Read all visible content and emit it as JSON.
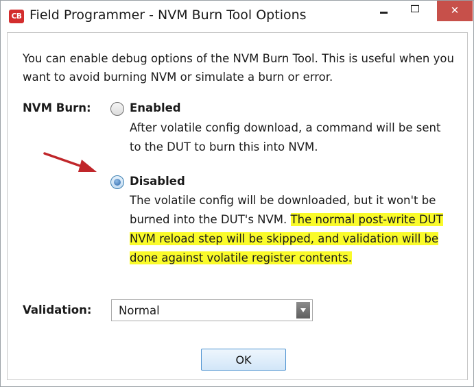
{
  "window": {
    "app_icon_text": "CB",
    "title": "Field Programmer - NVM Burn Tool Options",
    "close_glyph": "✕"
  },
  "intro": {
    "text": "You can enable debug options of the NVM Burn Tool. This is useful when you want to avoid burning NVM or simulate a burn or error."
  },
  "nvm_burn": {
    "label": "NVM Burn:",
    "options": [
      {
        "title": "Enabled",
        "checked": false,
        "description": "After volatile config download, a command will be sent to the DUT to burn this into NVM."
      },
      {
        "title": "Disabled",
        "checked": true,
        "description": "The volatile config will be downloaded, but it won't be burned into the DUT's NVM.",
        "highlighted_description": "The normal post-write DUT NVM reload step will be skipped, and validation will be done against volatile register contents."
      }
    ]
  },
  "validation": {
    "label": "Validation:",
    "selected": "Normal"
  },
  "ok_button": {
    "label": "OK"
  },
  "colors": {
    "highlight": "#fafb2a",
    "arrow": "#c0262a",
    "close_button": "#c7504a",
    "app_icon": "#d32d2d",
    "ok_border": "#4a90d0"
  },
  "icons": {
    "app": "cb-app-icon",
    "minimize": "minimize-icon",
    "maximize": "maximize-icon",
    "close": "close-icon",
    "dropdown": "chevron-down-icon",
    "annotation": "red-arrow-icon"
  }
}
